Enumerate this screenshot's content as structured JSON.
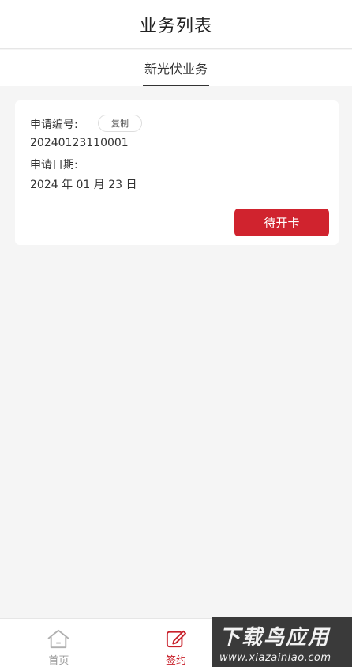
{
  "header": {
    "title": "业务列表"
  },
  "tabs": [
    {
      "label": "新光伏业务",
      "active": true
    }
  ],
  "card": {
    "application_no_label": "申请编号:",
    "copy_label": "复制",
    "application_no": "20240123110001",
    "application_date_label": "申请日期:",
    "application_date": "2024 年 01 月 23 日",
    "status_label": "待开卡"
  },
  "tabbar": {
    "items": [
      {
        "label": "首页",
        "icon": "home-icon",
        "active": false
      },
      {
        "label": "签约",
        "icon": "edit-icon",
        "active": true
      }
    ]
  },
  "watermark": {
    "title": "下载鸟应用",
    "url": "www.xiazainiao.com"
  },
  "colors": {
    "accent": "#d0232e",
    "background": "#f5f5f5",
    "inactive": "#9a9a9a"
  }
}
